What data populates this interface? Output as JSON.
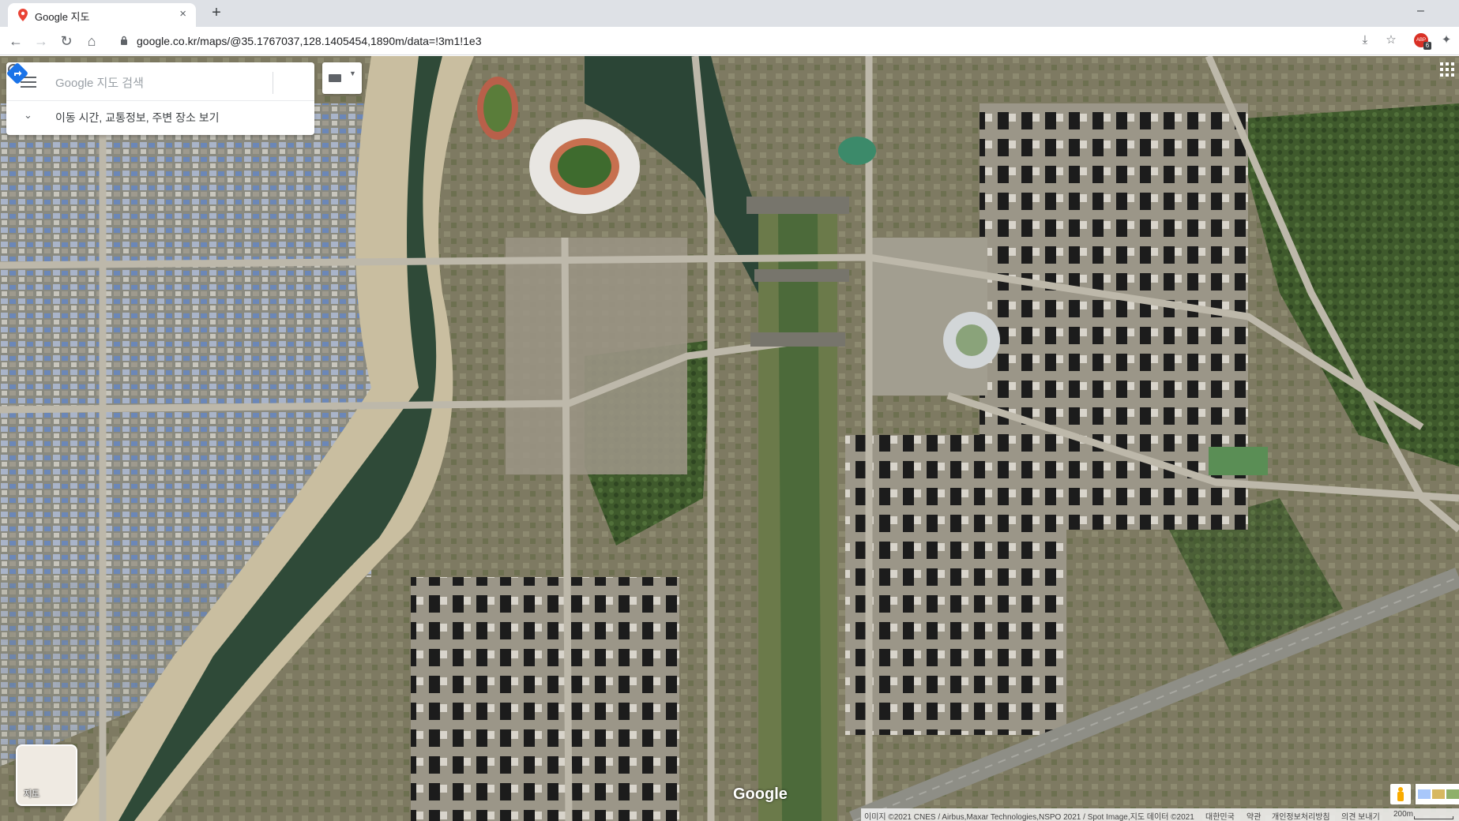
{
  "browser": {
    "tab_title": "Google 지도",
    "new_tab_label": "+",
    "url": "google.co.kr/maps/@35.1767037,128.1405454,1890m/data=!3m1!1e3",
    "extension_badge": "ABP",
    "extension_badge_count": "6"
  },
  "search": {
    "placeholder": "Google 지도 검색",
    "explore_label": "이동 시간, 교통정보, 주변 장소 보기"
  },
  "map": {
    "layer_label": "지도",
    "logo": "Google",
    "attribution": "이미지 ©2021 CNES / Airbus,Maxar Technologies,NSPO 2021 / Spot Image,지도 데이터 ©2021",
    "footer_links": [
      "대한민국",
      "약관",
      "개인정보처리방침",
      "의견 보내기"
    ],
    "scale_label": "200m"
  },
  "colors": {
    "map_marker_red": "#ea4335",
    "directions_blue": "#1a73e8",
    "pegman_yellow": "#f9ab00"
  }
}
